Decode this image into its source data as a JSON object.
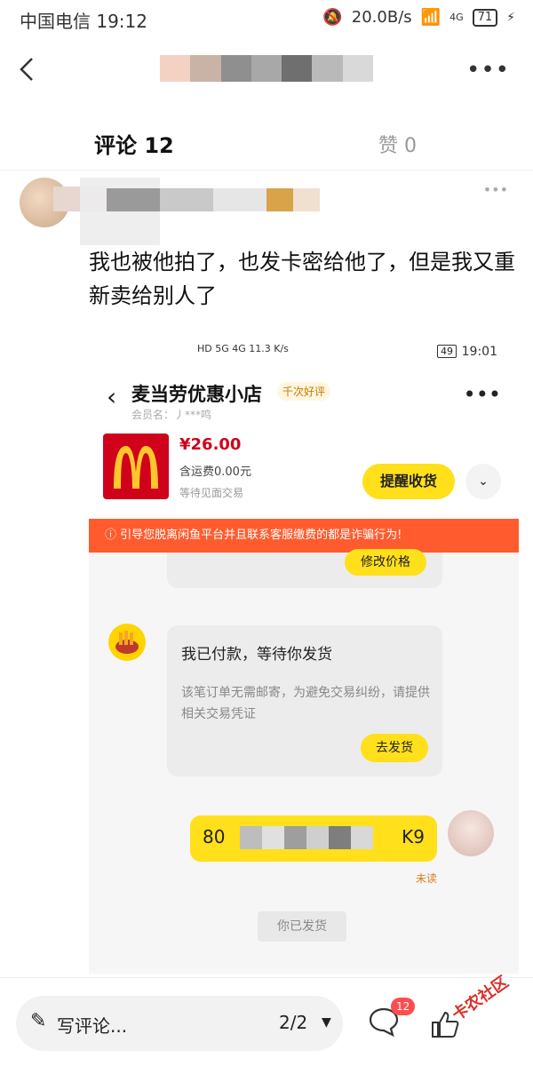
{
  "status_bar": {
    "carrier_time": "中国电信 19:12",
    "speed": "20.0B/s",
    "network": "4G",
    "battery": "71"
  },
  "nav": {
    "back_icon": "chevron-left-icon",
    "more_label": "•••"
  },
  "tabs": {
    "comments": "评论 12",
    "likes": "赞 0"
  },
  "comment": {
    "more_label": "•••",
    "text": "我也被他拍了，也发卡密给他了，但是我又重新卖给别人了"
  },
  "embedded": {
    "status": {
      "icons": "HD 5G 4G 11.3 K/s",
      "battery": "49",
      "time": "19:01"
    },
    "shop": {
      "back": "‹",
      "name": "麦当劳优惠小店",
      "badge": "千次好评",
      "member": "会员名：丿***鸣",
      "more": "•••"
    },
    "order": {
      "price": "¥26.00",
      "shipping": "含运费0.00元",
      "state": "等待见面交易",
      "remind_button": "提醒收货",
      "expand": "⌄"
    },
    "warning": "ⓘ 引导您脱离闲鱼平台并且联系客服缴费的都是诈骗行为!",
    "modify_button": "修改价格",
    "message_card": {
      "title": "我已付款，等待你发货",
      "desc": "该笔订单无需邮寄，为避免交易纠纷，请提供相关交易凭证",
      "button": "去发货"
    },
    "code_message": {
      "start": "80",
      "end": "K9"
    },
    "unread": "未读",
    "shipped": "你已发货"
  },
  "bottom": {
    "input_label": "写评论...",
    "page": "2/2",
    "comment_count": "12",
    "watermark": "卡农社区"
  },
  "colors": {
    "accent_yellow": "#ffe01b",
    "warning_orange": "#ff5b2e",
    "price_red": "#d0021b",
    "badge_red": "#ff4d4f"
  }
}
